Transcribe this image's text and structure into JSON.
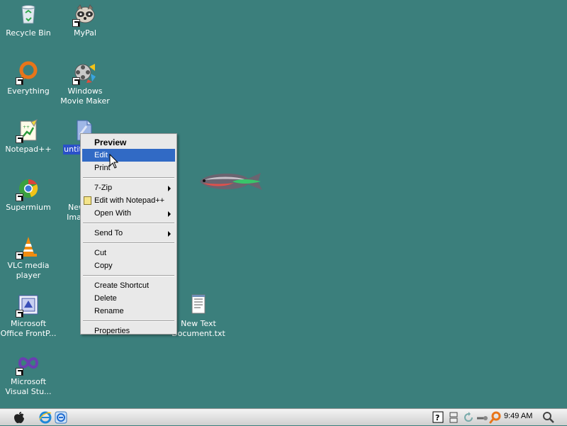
{
  "desktop": {
    "icons": {
      "recycle_bin": "Recycle Bin",
      "mypal": "MyPal",
      "everything": "Everything",
      "movie_maker_1": "Windows",
      "movie_maker_2": "Movie Maker",
      "notepadpp": "Notepad++",
      "untitled": "untit",
      "supermium": "Supermium",
      "new_image_1": "New",
      "new_image_2": "Imag",
      "vlc_1": "VLC media",
      "vlc_2": "player",
      "frontpage_1": "Microsoft",
      "frontpage_2": "Office FrontP...",
      "new_text_1": "New Text",
      "new_text_2": "Document.txt",
      "visual_studio_1": "Microsoft",
      "visual_studio_2": "Visual Stu..."
    }
  },
  "context_menu": {
    "preview": "Preview",
    "edit": "Edit",
    "print": "Print",
    "seven_zip": "7-Zip",
    "edit_notepadpp": "Edit with Notepad++",
    "open_with": "Open With",
    "send_to": "Send To",
    "cut": "Cut",
    "copy": "Copy",
    "create_shortcut": "Create Shortcut",
    "delete": "Delete",
    "rename": "Rename",
    "properties": "Properties"
  },
  "taskbar": {
    "clock": "9:49 AM"
  },
  "colors": {
    "desktop": "#3b7f7c",
    "menu_highlight": "#316ac5",
    "selection": "#2a50c8"
  }
}
